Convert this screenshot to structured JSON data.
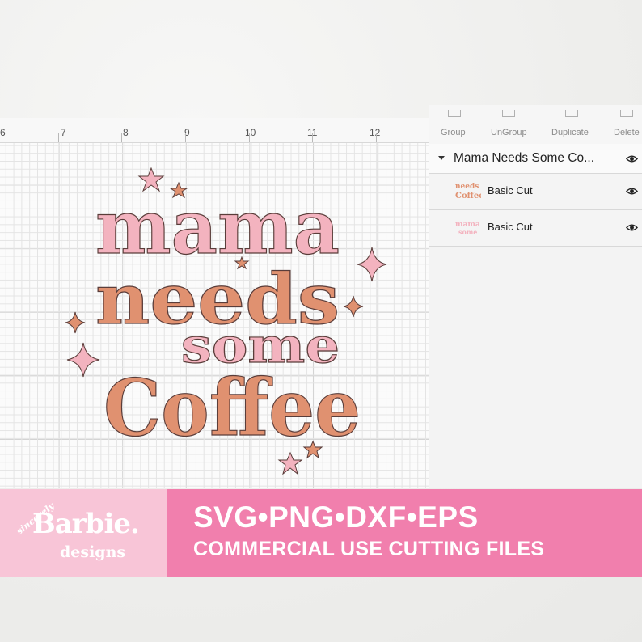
{
  "canvas": {
    "ruler_numbers": [
      "6",
      "7",
      "8",
      "9",
      "10",
      "11",
      "12"
    ]
  },
  "artwork": {
    "line1": "mama",
    "line2": "needs",
    "line3": "some",
    "line4": "Coffee",
    "colors": {
      "pink": "#f3b3bf",
      "orange": "#e09170",
      "outline": "#5a3d3a"
    }
  },
  "toolbar": {
    "group": "Group",
    "ungroup": "UnGroup",
    "duplicate": "Duplicate",
    "delete": "Delete"
  },
  "layers": {
    "group_title": "Mama Needs Some Co...",
    "items": [
      {
        "label": "Basic Cut",
        "icon": "eye-icon"
      },
      {
        "label": "Basic Cut",
        "icon": "eye-icon"
      }
    ]
  },
  "banner": {
    "formats": "SVG•PNG•DXF•EPS",
    "tagline": "COMMERCIAL USE CUTTING FILES",
    "logo": {
      "top": "sincerely",
      "main": "Barbie.",
      "bottom": "designs"
    },
    "colors": {
      "light": "#f8c5d7",
      "dark": "#f17fad"
    }
  }
}
